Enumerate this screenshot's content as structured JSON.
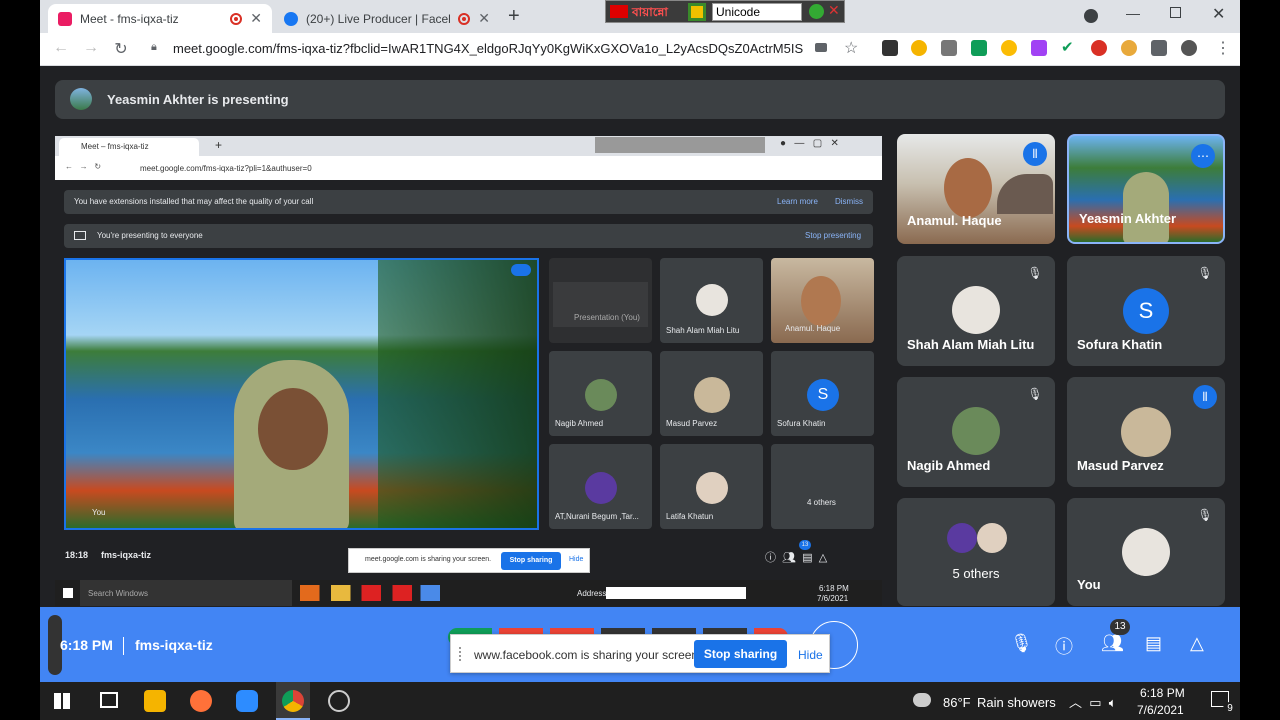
{
  "tabs": [
    {
      "title": "Meet - fms-iqxa-tiz",
      "color": "#ea1d63"
    },
    {
      "title": "(20+) Live Producer | Facebo",
      "color": "#1877f2"
    }
  ],
  "keyboard_widget": {
    "lang": "বায়ান্নো",
    "encoding": "Unicode"
  },
  "address_bar": {
    "url": "meet.google.com/fms-iqxa-tiz?fbclid=IwAR1TNG4X_eldgoRJqYy0KgWiKxGXOVa1o_L2yAcsDQsZ0ActrM5IS..."
  },
  "presenting_banner": {
    "text": "Yeasmin Akhter is presenting"
  },
  "nested": {
    "tab_title": "Meet – fms-iqxa-tiz",
    "url": "meet.google.com/fms-iqxa-tiz?pli=1&authuser=0",
    "notice": "You have extensions installed that may affect the quality of your call",
    "learn_more": "Learn more",
    "dismiss": "Dismiss",
    "presenting": "You're presenting to everyone",
    "stop_presenting": "Stop presenting",
    "self_label": "You",
    "presentation_label": "Presentation (You)",
    "tiles": [
      {
        "name": "Shah Alam Miah Litu"
      },
      {
        "name": "Anamul. Haque"
      },
      {
        "name": "Nagib Ahmed"
      },
      {
        "name": "Masud Parvez"
      },
      {
        "name": "Sofura Khatin",
        "initial": "S"
      },
      {
        "name": "AT,Nurani Begum ,Tar..."
      },
      {
        "name": "Latifa Khatun"
      },
      {
        "name": "4 others"
      }
    ],
    "time": "18:18",
    "meeting_code": "fms-iqxa-tiz",
    "people_count": "13",
    "share_notice": "meet.google.com is sharing your screen.",
    "stop_sharing": "Stop sharing",
    "hide": "Hide",
    "taskbar_search": "Search Windows",
    "address_label": "Address",
    "clock_time": "6:18 PM",
    "clock_date": "7/6/2021"
  },
  "participants": [
    {
      "name": "Anamul. Haque",
      "speaking": true
    },
    {
      "name": "Yeasmin Akhter",
      "speaking": true
    },
    {
      "name": "Shah Alam Miah Litu",
      "muted": true
    },
    {
      "name": "Sofura Khatin",
      "initial": "S",
      "muted": true
    },
    {
      "name": "Nagib Ahmed",
      "muted": true
    },
    {
      "name": "Masud Parvez",
      "speaking": true
    },
    {
      "name": "5 others"
    },
    {
      "name": "You",
      "muted": true
    }
  ],
  "bottom_bar": {
    "time": "6:18 PM",
    "meeting_code": "fms-iqxa-tiz",
    "people_count": "13",
    "share_notice": "www.facebook.com is sharing your screen.",
    "stop_sharing": "Stop sharing",
    "hide": "Hide"
  },
  "taskbar": {
    "weather_temp": "86°F",
    "weather_desc": "Rain showers",
    "time": "6:18 PM",
    "date": "7/6/2021",
    "notification_count": "9"
  },
  "colors": {
    "meet_bg": "#202124",
    "tile_bg": "#3c4043",
    "accent": "#1a73e8",
    "bottom_bar": "#4285f4"
  }
}
